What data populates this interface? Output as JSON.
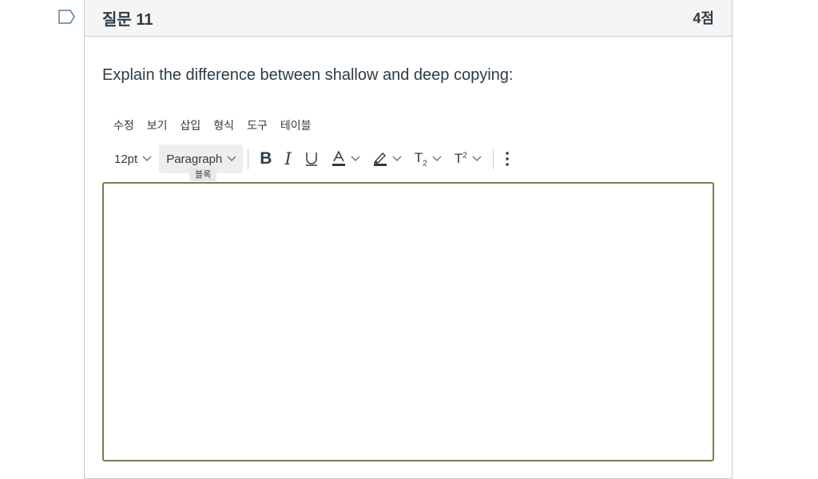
{
  "question": {
    "title": "질문 11",
    "points": "4점",
    "text": "Explain the difference between shallow and deep copying:"
  },
  "menubar": {
    "items": [
      "수정",
      "보기",
      "삽입",
      "형식",
      "도구",
      "테이블"
    ]
  },
  "toolbar": {
    "font_size": "12pt",
    "block_format": "Paragraph",
    "block_tooltip": "블록",
    "icons": [
      "bold-icon",
      "italic-icon",
      "underline-icon",
      "text-color-icon",
      "highlight-icon",
      "subscript-icon",
      "superscript-icon",
      "more-options-icon"
    ]
  },
  "editor": {
    "value": ""
  },
  "colors": {
    "editor_border": "#807950",
    "header_bg": "#f5f5f5",
    "text": "#2d3b45"
  }
}
